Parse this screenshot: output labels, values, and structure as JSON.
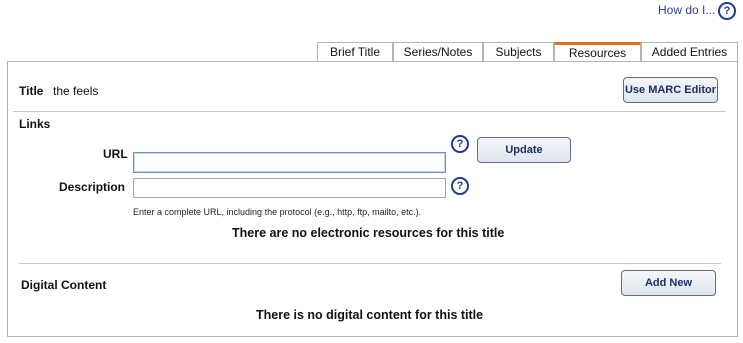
{
  "help": {
    "how_do_i": "How do I...",
    "icon": "question-circle-icon",
    "glyph": "?"
  },
  "tabs": [
    {
      "label": "Brief Title",
      "active": false
    },
    {
      "label": "Series/Notes",
      "active": false
    },
    {
      "label": "Subjects",
      "active": false
    },
    {
      "label": "Resources",
      "active": true
    },
    {
      "label": "Added Entries",
      "active": false
    }
  ],
  "title_row": {
    "label": "Title",
    "value": "the feels",
    "marc_button": "Use MARC Editor"
  },
  "links": {
    "heading": "Links",
    "url_label": "URL",
    "url_value": "",
    "description_label": "Description",
    "description_value": "",
    "update_button": "Update",
    "hint": "Enter a complete URL, including the protocol (e.g., http, ftp, mailto, etc.).",
    "empty_message": "There are no electronic resources for this title"
  },
  "digital": {
    "heading": "Digital Content",
    "add_button": "Add New",
    "empty_message": "There is no digital content for this title"
  },
  "colors": {
    "active_tab_accent": "#e46f1f",
    "link": "#2a3f8f",
    "button_text": "#1b2f66"
  }
}
